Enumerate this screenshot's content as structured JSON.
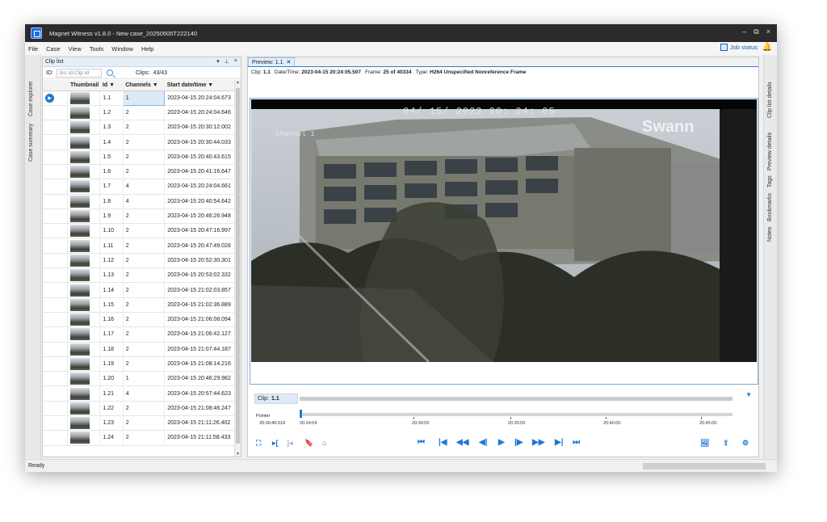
{
  "window": {
    "title": "Magnet Witness v1.8.0 - New case_20250505T222140",
    "controls": [
      "–",
      "⧉",
      "×"
    ]
  },
  "menu": [
    "File",
    "Case",
    "View",
    "Tools",
    "Window",
    "Help"
  ],
  "job_status": "Job status",
  "left_rail": [
    "Case explorer",
    "Case summary"
  ],
  "right_rail": [
    "Clip list details",
    "Preview details",
    "Tags",
    "Bookmarks",
    "Notes"
  ],
  "clip_list": {
    "title": "Clip list",
    "header_controls": [
      "▾",
      "⊥",
      "×"
    ],
    "id_label": "ID:",
    "id_placeholder": "Src Id.Clip Id",
    "clips_label": "Clips:",
    "clips_count": "43/43",
    "columns": [
      "Thumbnail",
      "Id",
      "Channels",
      "Start date/time"
    ],
    "rows": [
      {
        "id": "1.1",
        "channels": "1",
        "start": "2023-04-15 20:24:04.673"
      },
      {
        "id": "1.2",
        "channels": "2",
        "start": "2023-04-15 20:24:04.646"
      },
      {
        "id": "1.3",
        "channels": "2",
        "start": "2023-04-15 20:30:12.002"
      },
      {
        "id": "1.4",
        "channels": "2",
        "start": "2023-04-15 20:30:44.033"
      },
      {
        "id": "1.5",
        "channels": "2",
        "start": "2023-04-15 20:40:43.615"
      },
      {
        "id": "1.6",
        "channels": "2",
        "start": "2023-04-15 20:41:16.647"
      },
      {
        "id": "1.7",
        "channels": "4",
        "start": "2023-04-15 20:24:04.661"
      },
      {
        "id": "1.8",
        "channels": "4",
        "start": "2023-04-15 20:40:54.642"
      },
      {
        "id": "1.9",
        "channels": "2",
        "start": "2023-04-15 20:46:26.948"
      },
      {
        "id": "1.10",
        "channels": "2",
        "start": "2023-04-15 20:47:16.997"
      },
      {
        "id": "1.11",
        "channels": "2",
        "start": "2023-04-15 20:47:49.028"
      },
      {
        "id": "1.12",
        "channels": "2",
        "start": "2023-04-15 20:52:30.301"
      },
      {
        "id": "1.13",
        "channels": "2",
        "start": "2023-04-15 20:53:02.332"
      },
      {
        "id": "1.14",
        "channels": "2",
        "start": "2023-04-15 21:02:03.857"
      },
      {
        "id": "1.15",
        "channels": "2",
        "start": "2023-04-15 21:02:36.889"
      },
      {
        "id": "1.16",
        "channels": "2",
        "start": "2023-04-15 21:06:08.094"
      },
      {
        "id": "1.17",
        "channels": "2",
        "start": "2023-04-15 21:06:42.127"
      },
      {
        "id": "1.18",
        "channels": "2",
        "start": "2023-04-15 21:07:44.187"
      },
      {
        "id": "1.19",
        "channels": "2",
        "start": "2023-04-15 21:08:14.216"
      },
      {
        "id": "1.20",
        "channels": "1",
        "start": "2023-04-15 20:46:29.982"
      },
      {
        "id": "1.21",
        "channels": "4",
        "start": "2023-04-15 20:57:44.623"
      },
      {
        "id": "1.22",
        "channels": "2",
        "start": "2023-04-15 21:08:46.247"
      },
      {
        "id": "1.23",
        "channels": "2",
        "start": "2023-04-15 21:11:26.402"
      },
      {
        "id": "1.24",
        "channels": "2",
        "start": "2023-04-15 21:11:58.433"
      }
    ]
  },
  "preview": {
    "tab_label": "Preview: 1.1",
    "info": {
      "clip_label": "Clip:",
      "clip": "1.1",
      "datetime_label": "Date/Time:",
      "datetime": "2023-04-15 20:24:05.507",
      "frame_label": "Frame:",
      "frame": "25",
      "frame_of": "of",
      "frame_total": "40334",
      "type_label": "Type:",
      "type": "H264 Unspecified Nonreference Frame"
    },
    "overlay_timestamp": "04/ 15/ 2023  20: 24: 05",
    "overlay_channel": "Channel 1",
    "overlay_brand": "Swann",
    "timeline": {
      "clip_label": "Clip:",
      "clip_value": "1.1",
      "pointer_label": "Pointer",
      "pointer_value": "20:30:40.519",
      "ticks": [
        "20:24:04",
        "20:30:00",
        "20:35:00",
        "20:40:00",
        "20:45:00"
      ]
    }
  },
  "status": {
    "text": "Ready"
  }
}
